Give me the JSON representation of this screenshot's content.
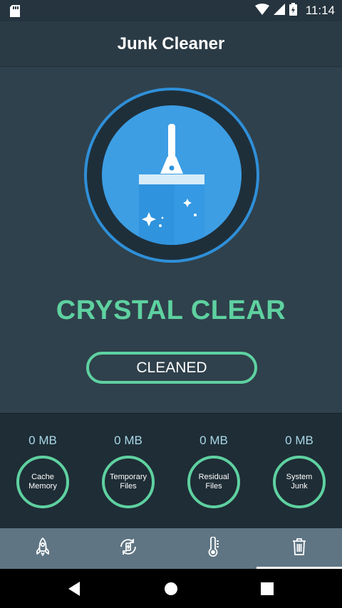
{
  "status_bar": {
    "time": "11:14"
  },
  "app_bar": {
    "title": "Junk Cleaner"
  },
  "hero": {
    "status": "CRYSTAL CLEAR",
    "button_label": "CLEANED"
  },
  "stats": [
    {
      "size": "0 MB",
      "label": "Cache\nMemory"
    },
    {
      "size": "0 MB",
      "label": "Temporary\nFiles"
    },
    {
      "size": "0 MB",
      "label": "Residual\nFiles"
    },
    {
      "size": "0 MB",
      "label": "System\nJunk"
    }
  ],
  "tabs": [
    {
      "icon": "rocket-icon"
    },
    {
      "icon": "battery-sync-icon"
    },
    {
      "icon": "thermometer-icon"
    },
    {
      "icon": "trash-icon",
      "active": true
    }
  ],
  "colors": {
    "accent": "#5ed1a0",
    "ring": "#2f8fd8",
    "background": "#2f414c"
  }
}
